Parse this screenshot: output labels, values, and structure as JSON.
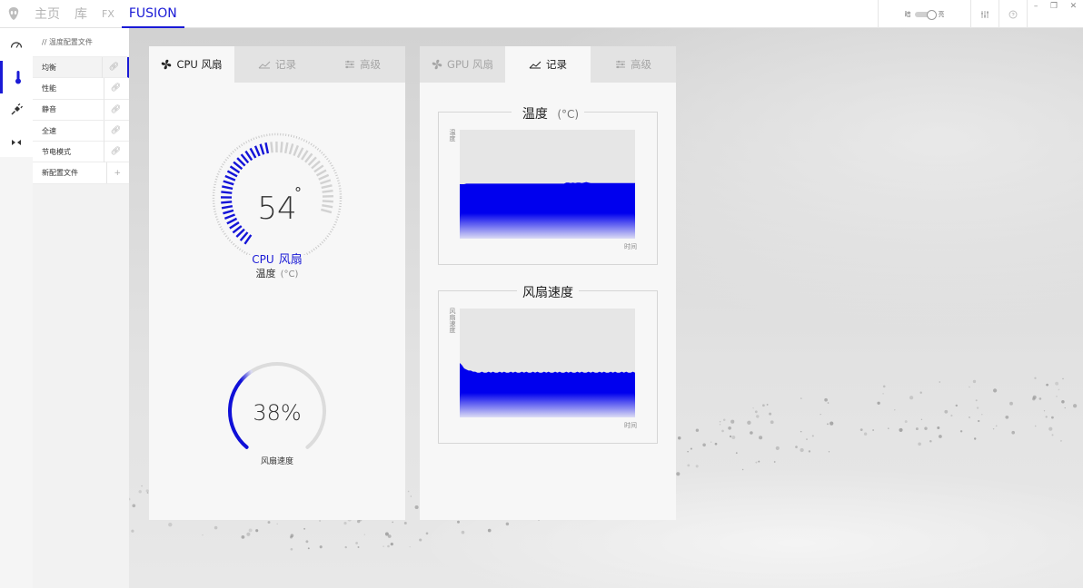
{
  "nav": {
    "items": [
      {
        "label": "主页",
        "active": false
      },
      {
        "label": "库",
        "active": false
      },
      {
        "label": "FX",
        "active": false
      },
      {
        "label": "FUSION",
        "active": true
      }
    ],
    "brightness_low": "暗",
    "brightness_high": "亮",
    "minimize": "–",
    "restore": "❐",
    "close": "✕"
  },
  "sidebar": {
    "header": "// 温度配置文件",
    "profiles": [
      {
        "label": "均衡",
        "selected": true
      },
      {
        "label": "性能",
        "selected": false
      },
      {
        "label": "静音",
        "selected": false
      },
      {
        "label": "全速",
        "selected": false
      },
      {
        "label": "节电模式",
        "selected": false
      }
    ],
    "new_profile": "新配置文件"
  },
  "cpu_panel": {
    "tabs": [
      {
        "label": "CPU 风扇",
        "icon": "fan-icon",
        "active": true
      },
      {
        "label": "记录",
        "icon": "chart-icon",
        "active": false
      },
      {
        "label": "高级",
        "icon": "sliders-icon",
        "active": false
      }
    ],
    "temp_value": "54",
    "temp_degree": "°",
    "temp_fraction": 0.55,
    "fan_title_prefix": "CPU",
    "fan_title": "风扇",
    "temp_label": "温度",
    "temp_unit": "(°C)",
    "fan_speed_value": "38%",
    "fan_speed_fraction": 0.38,
    "fan_speed_label": "风扇速度"
  },
  "gpu_panel": {
    "tabs": [
      {
        "label": "GPU 风扇",
        "icon": "fan-icon",
        "active": false
      },
      {
        "label": "记录",
        "icon": "chart-icon",
        "active": true
      },
      {
        "label": "高级",
        "icon": "sliders-icon",
        "active": false
      }
    ]
  },
  "chart_data": [
    {
      "type": "area",
      "title": "温度",
      "title_unit": "(°C)",
      "ylabel": "温度",
      "xlabel": "时间",
      "grid": false,
      "color": "#0000ee",
      "values": [
        50,
        50,
        50,
        50.5,
        50.5,
        50.5,
        50.5,
        50.5,
        50.5,
        50.5,
        50.5,
        50.5,
        50.5,
        50.5,
        50.5,
        50.5,
        50.5,
        50.5,
        50.5,
        50.5,
        50.5,
        50.5,
        50.5,
        50.5,
        50.5,
        50.5,
        50.5,
        50.5,
        50.5,
        50.5,
        50.5,
        50.5,
        50.5,
        50.5,
        50.5,
        50.5,
        50.5,
        50.5,
        50.5,
        50.5,
        50.5,
        50.5,
        50.5,
        50.5,
        50.5,
        50.5,
        50.5,
        50.5,
        51.5,
        51.5,
        51,
        51.5,
        51,
        51.5,
        51.5,
        51,
        51.5,
        52,
        51.5,
        51,
        51,
        51,
        51,
        51,
        51,
        51,
        51,
        51,
        51,
        51,
        51,
        51,
        51,
        51,
        51,
        51,
        51,
        51,
        51,
        51
      ],
      "ylim": [
        0,
        100
      ]
    },
    {
      "type": "area",
      "title": "风扇速度",
      "ylabel": "风扇速度",
      "xlabel": "时间",
      "grid": false,
      "color": "#0000ee",
      "values": [
        50,
        48,
        45,
        44,
        43,
        43,
        42,
        42,
        41,
        41,
        42,
        41,
        41,
        42,
        41,
        42,
        41,
        41,
        42,
        41,
        42,
        41,
        41,
        42,
        41,
        42,
        41,
        41,
        42,
        41,
        42,
        41,
        41,
        42,
        41,
        42,
        41,
        41,
        42,
        41,
        42,
        41,
        41,
        42,
        41,
        42,
        41,
        41,
        42,
        41,
        42,
        41,
        41,
        42,
        41,
        42,
        41,
        41,
        42,
        41,
        42,
        41,
        41,
        42,
        41,
        42,
        41,
        41,
        42,
        41,
        42,
        41,
        41,
        42,
        41,
        42,
        41,
        41,
        42,
        41
      ],
      "ylim": [
        0,
        100
      ]
    }
  ]
}
